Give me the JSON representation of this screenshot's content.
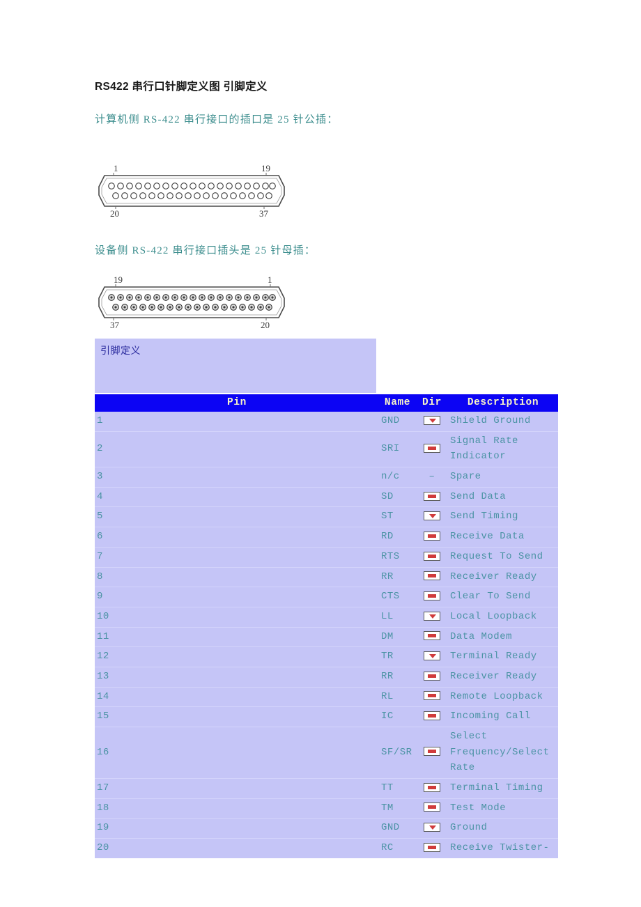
{
  "document": {
    "title": "RS422 串行口针脚定义图 引脚定义",
    "subtitle_1": "计算机侧 RS-422 串行接口的插口是 25 针公插：",
    "subtitle_2": "设备侧 RS-422 串行接口插头是 25 针母插："
  },
  "figures": {
    "computer_side": {
      "name": "db37-female-receptacle",
      "label_top_left": "1",
      "label_top_right": "19",
      "label_bottom_left": "20",
      "label_bottom_right": "37",
      "top_row_pins": 19,
      "bottom_row_pins": 18
    },
    "device_side": {
      "name": "db37-male-plug",
      "label_top_left": "19",
      "label_top_right": "1",
      "label_bottom_left": "37",
      "label_bottom_right": "20",
      "top_row_pins": 19,
      "bottom_row_pins": 18
    }
  },
  "caption": {
    "text": "引脚定义"
  },
  "colors": {
    "header_bg": "#0c04f4",
    "header_text": "#f7f3c8",
    "row_bg": "#c5c5f7",
    "row_text": "#4b93a4",
    "caption_bg": "#c5c5f7",
    "caption_text": "#2b2b9e",
    "subtitle_text": "#3d8e8e",
    "title_text": "#1a1a1a"
  },
  "table": {
    "headers": [
      "Pin",
      "Name",
      "Dir",
      "Description"
    ],
    "rows": [
      {
        "pin": "1",
        "name": "GND",
        "dir": "image-down",
        "desc": "Shield Ground"
      },
      {
        "pin": "2",
        "name": "SRI",
        "dir": "image-flat",
        "desc": "Signal Rate Indicator"
      },
      {
        "pin": "3",
        "name": "n/c",
        "dir": "dash",
        "desc": "Spare"
      },
      {
        "pin": "4",
        "name": "SD",
        "dir": "image-flat",
        "desc": "Send Data"
      },
      {
        "pin": "5",
        "name": "ST",
        "dir": "image-down",
        "desc": "Send Timing"
      },
      {
        "pin": "6",
        "name": "RD",
        "dir": "image-flat",
        "desc": "Receive Data"
      },
      {
        "pin": "7",
        "name": "RTS",
        "dir": "image-flat",
        "desc": "Request To Send"
      },
      {
        "pin": "8",
        "name": "RR",
        "dir": "image-flat",
        "desc": "Receiver Ready"
      },
      {
        "pin": "9",
        "name": "CTS",
        "dir": "image-flat",
        "desc": "Clear To Send"
      },
      {
        "pin": "10",
        "name": "LL",
        "dir": "image-down",
        "desc": "Local Loopback"
      },
      {
        "pin": "11",
        "name": "DM",
        "dir": "image-flat",
        "desc": "Data Modem"
      },
      {
        "pin": "12",
        "name": "TR",
        "dir": "image-down",
        "desc": "Terminal Ready"
      },
      {
        "pin": "13",
        "name": "RR",
        "dir": "image-flat",
        "desc": "Receiver Ready"
      },
      {
        "pin": "14",
        "name": "RL",
        "dir": "image-flat",
        "desc": "Remote Loopback"
      },
      {
        "pin": "15",
        "name": "IC",
        "dir": "image-flat",
        "desc": "Incoming Call"
      },
      {
        "pin": "16",
        "name": "SF/SR",
        "dir": "image-flat",
        "desc": "Select Frequency/Select Rate"
      },
      {
        "pin": "17",
        "name": "TT",
        "dir": "image-flat",
        "desc": "Terminal Timing"
      },
      {
        "pin": "18",
        "name": "TM",
        "dir": "image-flat",
        "desc": "Test Mode"
      },
      {
        "pin": "19",
        "name": "GND",
        "dir": "image-down",
        "desc": "Ground"
      },
      {
        "pin": "20",
        "name": "RC",
        "dir": "image-flat",
        "desc": "Receive Twister-"
      }
    ]
  }
}
